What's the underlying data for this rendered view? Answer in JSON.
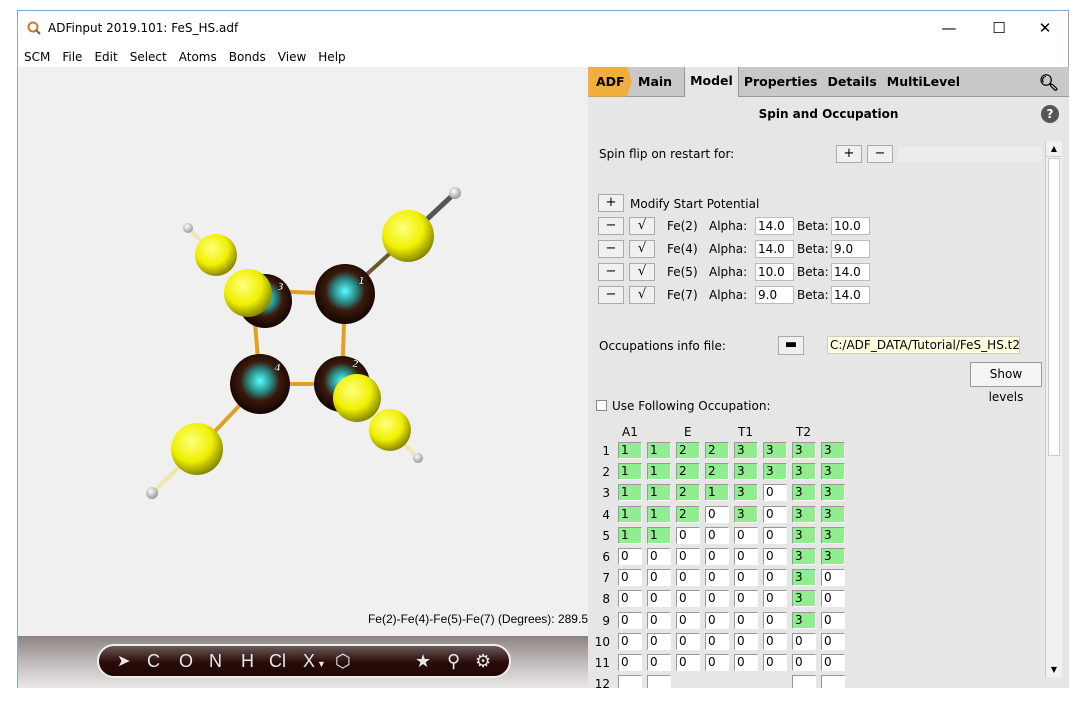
{
  "window": {
    "title": "ADFinput 2019.101: FeS_HS.adf",
    "minimize": "—",
    "maximize": "☐",
    "close": "✕"
  },
  "menu": [
    "SCM",
    "File",
    "Edit",
    "Select",
    "Atoms",
    "Bonds",
    "View",
    "Help"
  ],
  "viewer": {
    "measurement": "Fe(2)-Fe(4)-Fe(5)-Fe(7) (Degrees): 289.5",
    "atom_labels": [
      "1",
      "2",
      "3",
      "4"
    ],
    "toolbar": [
      "C",
      "O",
      "N",
      "H",
      "Cl",
      "X"
    ]
  },
  "tabs": [
    "ADF",
    "Main",
    "Model",
    "Properties",
    "Details",
    "MultiLevel"
  ],
  "active_tab": "Model",
  "panel": {
    "title": "Spin and Occupation",
    "help": "?",
    "spin_flip_label": "Spin flip on restart for:",
    "plus": "+",
    "minus": "−",
    "check": "√",
    "modify_label": "Modify Start Potential",
    "potentials": [
      {
        "atom": "Fe(2)",
        "alpha_label": "Alpha:",
        "alpha": "14.0",
        "beta_label": "Beta:",
        "beta": "10.0"
      },
      {
        "atom": "Fe(4)",
        "alpha_label": "Alpha:",
        "alpha": "14.0",
        "beta_label": "Beta:",
        "beta": "9.0"
      },
      {
        "atom": "Fe(5)",
        "alpha_label": "Alpha:",
        "alpha": "10.0",
        "beta_label": "Beta:",
        "beta": "14.0"
      },
      {
        "atom": "Fe(7)",
        "alpha_label": "Alpha:",
        "alpha": "9.0",
        "beta_label": "Beta:",
        "beta": "14.0"
      }
    ],
    "occ_file_label": "Occupations info file:",
    "occ_file": "C:/ADF_DATA/Tutorial/FeS_HS.t2",
    "show_levels": "Show levels",
    "use_occ_label": "Use Following Occupation:",
    "use_occ_checked": false,
    "columns": [
      "A1",
      "E",
      "T1",
      "T2"
    ],
    "filled_color": "#90ee90",
    "rows": [
      [
        "1",
        "1",
        "2",
        "2",
        "3",
        "3",
        "3",
        "3"
      ],
      [
        "1",
        "1",
        "2",
        "2",
        "3",
        "3",
        "3",
        "3"
      ],
      [
        "1",
        "1",
        "2",
        "1",
        "3",
        "0",
        "3",
        "3"
      ],
      [
        "1",
        "1",
        "2",
        "0",
        "3",
        "0",
        "3",
        "3"
      ],
      [
        "1",
        "1",
        "0",
        "0",
        "0",
        "0",
        "3",
        "3"
      ],
      [
        "0",
        "0",
        "0",
        "0",
        "0",
        "0",
        "3",
        "3"
      ],
      [
        "0",
        "0",
        "0",
        "0",
        "0",
        "0",
        "3",
        "0"
      ],
      [
        "0",
        "0",
        "0",
        "0",
        "0",
        "0",
        "3",
        "0"
      ],
      [
        "0",
        "0",
        "0",
        "0",
        "0",
        "0",
        "3",
        "0"
      ],
      [
        "0",
        "0",
        "0",
        "0",
        "0",
        "0",
        "0",
        "0"
      ],
      [
        "0",
        "0",
        "0",
        "0",
        "0",
        "0",
        "0",
        "0"
      ]
    ]
  }
}
